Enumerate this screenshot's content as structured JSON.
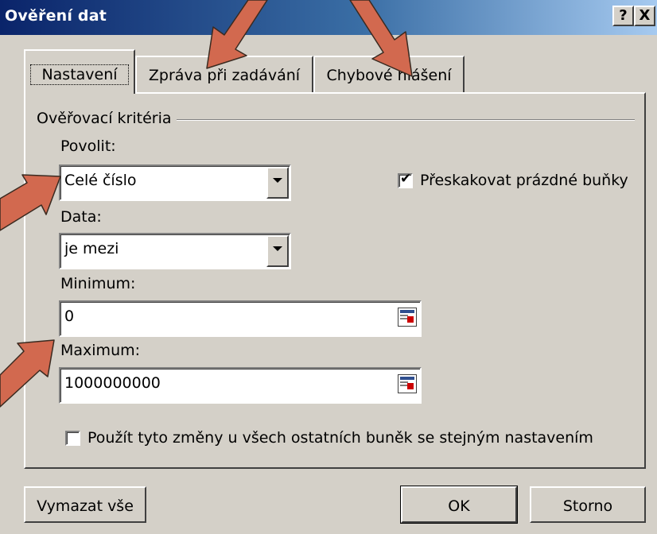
{
  "window": {
    "title": "Ověření dat",
    "help_button": "?",
    "close_button": "X"
  },
  "tabs": [
    {
      "label": "Nastavení",
      "active": true
    },
    {
      "label": "Zpráva při zadávání",
      "active": false
    },
    {
      "label": "Chybové hlášení",
      "active": false
    }
  ],
  "criteria": {
    "group_label": "Ověřovací kritéria",
    "allow_label": "Povolit:",
    "allow_value": "Celé číslo",
    "ignore_blank_label": "Přeskakovat prázdné buňky",
    "ignore_blank_checked": true,
    "data_label": "Data:",
    "data_value": "je mezi",
    "minimum_label": "Minimum:",
    "minimum_value": "0",
    "maximum_label": "Maximum:",
    "maximum_value": "1000000000",
    "apply_all_label": "Použít tyto změny u všech ostatních buněk se stejným nastavením",
    "apply_all_checked": false
  },
  "buttons": {
    "clear_all": "Vymazat vše",
    "ok": "OK",
    "cancel": "Storno"
  },
  "annotation_color": "#d2694f"
}
